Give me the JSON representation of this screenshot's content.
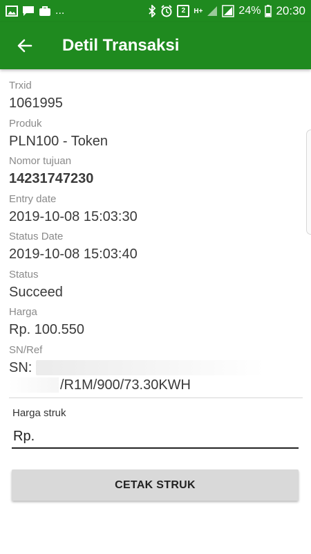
{
  "status_bar": {
    "left_icons": [
      "image-icon",
      "chat-icon",
      "bag-icon"
    ],
    "more": "...",
    "right_icons": [
      "bluetooth-icon",
      "alarm-icon"
    ],
    "sim_badge": "2",
    "network": "H+",
    "battery": "24%",
    "time": "20:30"
  },
  "app_bar": {
    "back_icon": "arrow-left-icon",
    "title": "Detil Transaksi"
  },
  "transaction": {
    "trxid_label": "Trxid",
    "trxid_value": "1061995",
    "produk_label": "Produk",
    "produk_value": "PLN100 -  Token",
    "tujuan_label": "Nomor tujuan",
    "tujuan_value": "14231747230",
    "entry_label": "Entry date",
    "entry_value": "2019-10-08 15:03:30",
    "status_date_label": "Status Date",
    "status_date_value": "2019-10-08 15:03:40",
    "status_label": "Status",
    "status_value": "Succeed",
    "harga_label": "Harga",
    "harga_value": "Rp. 100.550",
    "sn_label": "SN/Ref",
    "sn_value_line1": "SN: ",
    "sn_value_line2": "/R1M/900/73.30KWH"
  },
  "receipt": {
    "label": "Harga struk",
    "input_value": "Rp.",
    "button_label": "CETAK STRUK"
  },
  "colors": {
    "primary": "#1f8a1f",
    "button": "#d9d9d9"
  }
}
